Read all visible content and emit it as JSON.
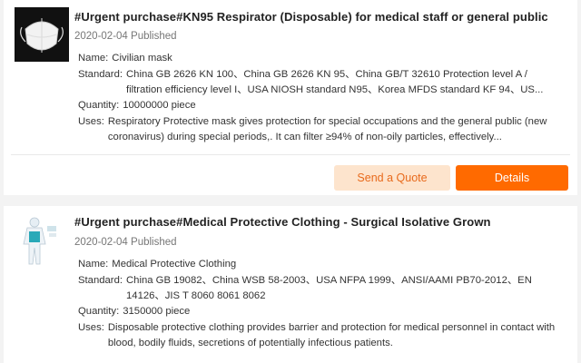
{
  "listings": [
    {
      "title": "#Urgent purchase#KN95 Respirator (Disposable) for medical staff or general public",
      "published": "2020-02-04 Published",
      "name_label": "Name:",
      "name_value": "Civilian mask",
      "standard_label": "Standard:",
      "standard_value": "China GB 2626 KN 100、China GB 2626 KN 95、China GB/T 32610 Protection level A / filtration efficiency level I、USA NIOSH standard N95、Korea MFDS standard KF 94、US...",
      "quantity_label": "Quantity:",
      "quantity_value": "10000000 piece",
      "uses_label": "Uses:",
      "uses_value": "Respiratory Protective mask gives protection for special occupations and the general public (new coronavirus) during special periods,. It can filter ≥94% of non-oily particles, effectively...",
      "quote_label": "Send a Quote",
      "details_label": "Details",
      "thumb_icon": "mask-icon"
    },
    {
      "title": "#Urgent purchase#Medical Protective Clothing - Surgical Isolative Grown",
      "published": "2020-02-04 Published",
      "name_label": "Name:",
      "name_value": "Medical Protective Clothing",
      "standard_label": "Standard:",
      "standard_value": "China GB 19082、China WSB 58-2003、USA NFPA 1999、ANSI/AAMI PB70-2012、EN 14126、JIS T 8060 8061 8062",
      "quantity_label": "Quantity:",
      "quantity_value": "3150000 piece",
      "uses_label": "Uses:",
      "uses_value": "Disposable protective clothing provides barrier and protection for medical personnel in contact with blood, bodily fluids, secretions of potentially infectious patients.",
      "thumb_icon": "protective-suit-icon"
    }
  ],
  "colors": {
    "accent": "#ff6a00",
    "quote_bg": "#fde4cd",
    "quote_text": "#e86a1c",
    "page_bg": "#f3f3f3"
  }
}
